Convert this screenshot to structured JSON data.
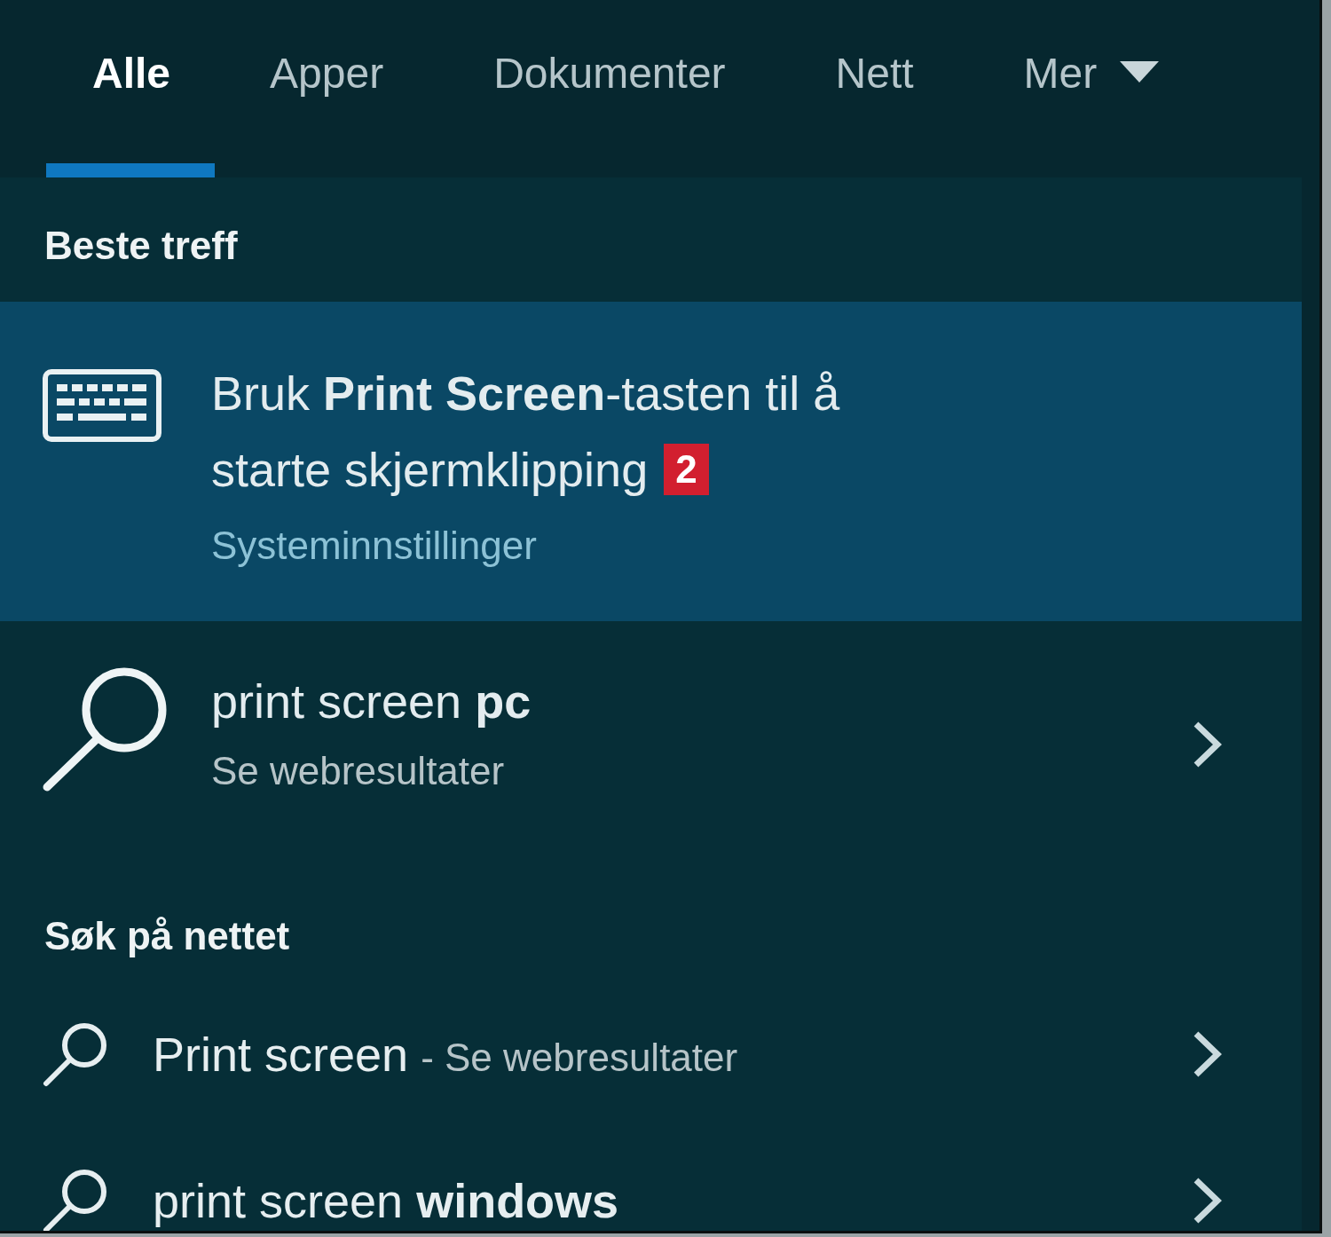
{
  "tabs": [
    {
      "label": "Alle",
      "selected": true,
      "kind": "plain"
    },
    {
      "label": "Apper",
      "selected": false,
      "kind": "plain"
    },
    {
      "label": "Dokumenter",
      "selected": false,
      "kind": "plain"
    },
    {
      "label": "Nett",
      "selected": false,
      "kind": "plain"
    },
    {
      "label": "Mer",
      "selected": false,
      "kind": "dropdown"
    }
  ],
  "best_match": {
    "heading": "Beste treff",
    "title_lines": [
      "Bruk **Print Screen**-tasten til å",
      "starte skjermklipping"
    ],
    "badge": "2",
    "subtitle": "Systeminnstillinger",
    "selected": true
  },
  "top_web_result": {
    "title": "print screen **pc**",
    "subtitle": "Se webresultater"
  },
  "web_search": {
    "heading": "Søk på nettet",
    "suggestions": [
      {
        "title": "Print screen",
        "suffix": "- Se webresultater"
      },
      {
        "title": "print screen **windows**"
      }
    ]
  }
}
